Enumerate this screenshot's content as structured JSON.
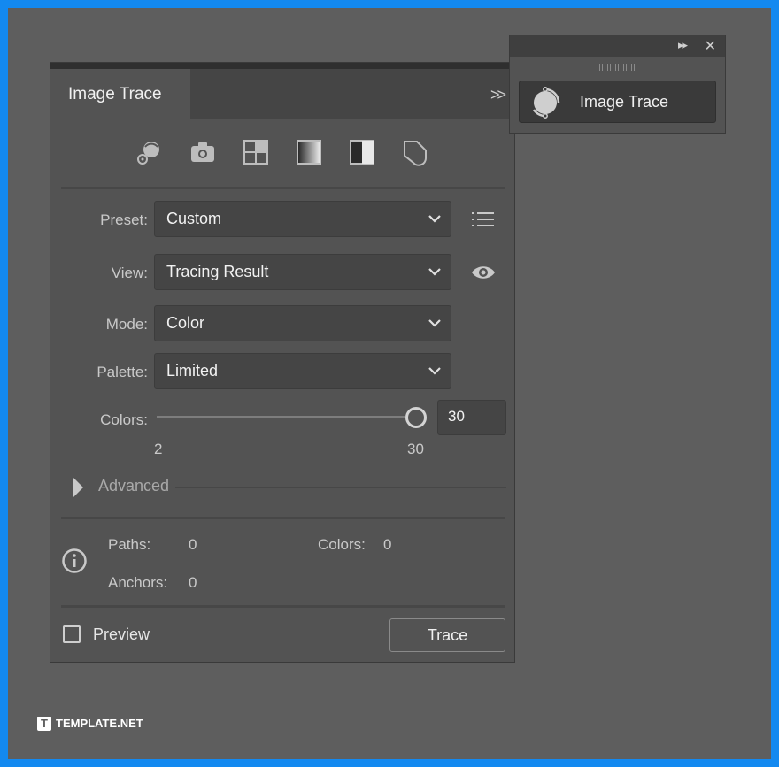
{
  "panel": {
    "tab_title": "Image Trace",
    "expand_glyph": ">>",
    "presets": [
      "auto-color-icon",
      "high-color-icon",
      "low-color-icon",
      "grayscale-icon",
      "black-and-white-icon",
      "outline-icon"
    ],
    "preset": {
      "label": "Preset:",
      "value": "Custom"
    },
    "view": {
      "label": "View:",
      "value": "Tracing Result"
    },
    "mode": {
      "label": "Mode:",
      "value": "Color"
    },
    "palette": {
      "label": "Palette:",
      "value": "Limited"
    },
    "colors": {
      "label": "Colors:",
      "value": "30",
      "min_label": "2",
      "max_label": "30",
      "min": 2,
      "max": 30,
      "current": 30
    },
    "advanced": {
      "label": "Advanced"
    },
    "stats": {
      "paths_label": "Paths:",
      "paths_value": "0",
      "colors_label": "Colors:",
      "colors_value": "0",
      "anchors_label": "Anchors:",
      "anchors_value": "0"
    },
    "preview_label": "Preview",
    "trace_button": "Trace"
  },
  "collapsed_panel": {
    "expand_glyph": "▸▸",
    "close_glyph": "✕",
    "button_label": "Image Trace"
  },
  "watermark": {
    "logo_letter": "T",
    "text": "TEMPLATE.NET"
  },
  "colors": {
    "background": "#1389f0",
    "canvas": "#5e5e5e",
    "panel": "#535353",
    "field": "#454545"
  }
}
